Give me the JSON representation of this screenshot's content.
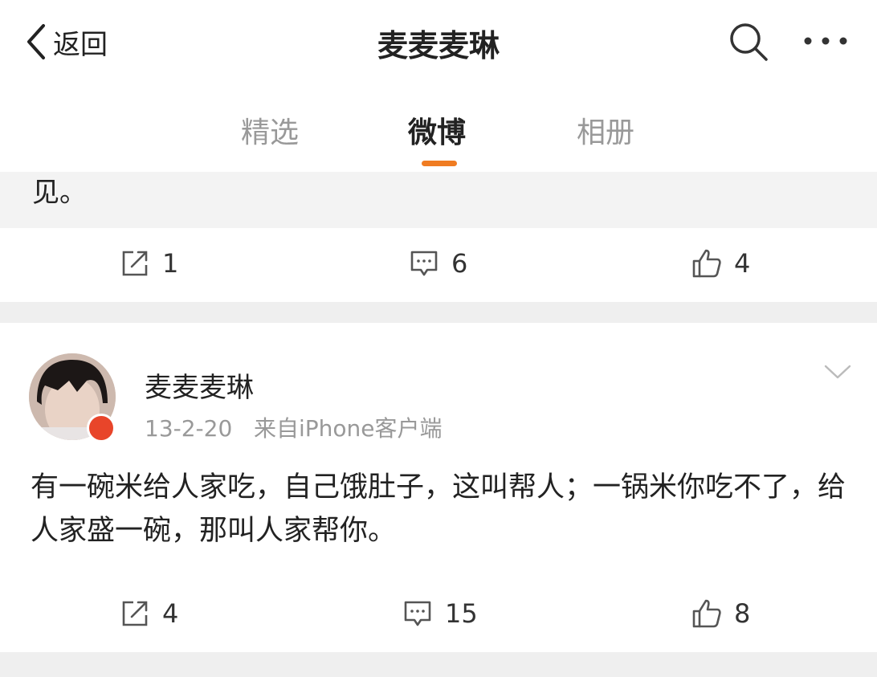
{
  "header": {
    "back_label": "返回",
    "title": "麦麦麦琳",
    "search_icon": "search-icon",
    "more_icon": "more-icon"
  },
  "tabs": [
    {
      "label": "精选",
      "active": false
    },
    {
      "label": "微博",
      "active": true
    },
    {
      "label": "相册",
      "active": false
    }
  ],
  "accent_color": "#f07c22",
  "post1": {
    "text_tail": "见。",
    "repost_count": "1",
    "comment_count": "6",
    "like_count": "4"
  },
  "post2": {
    "author": "麦麦麦琳",
    "date": "13-2-20",
    "source": "来自iPhone客户端",
    "text": "有一碗米给人家吃，自己饿肚子，这叫帮人；一锅米你吃不了，给人家盛一碗，那叫人家帮你。",
    "repost_count": "4",
    "comment_count": "15",
    "like_count": "8"
  }
}
